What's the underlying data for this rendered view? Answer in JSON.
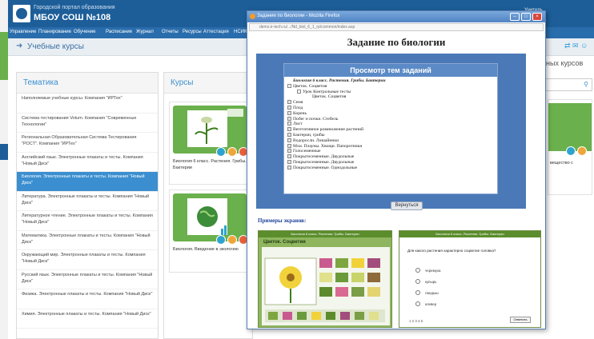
{
  "portal": {
    "city": "Городской портал образования",
    "school": "МБОУ СОШ №108",
    "user_line1": "Учитель",
    "user_line2": "Выход",
    "nav": [
      "Управление",
      "Планирование",
      "Обучение",
      "Расписание",
      "Журнал",
      "Отчеты",
      "Ресурсы",
      "Аттестация",
      "НСИКО"
    ],
    "breadcrumb": "Учебные курсы",
    "thematic_title": "Тематика",
    "courses_title": "Курсы",
    "right_title": "ных курсов",
    "topics": [
      "Наполняемые учебные курсы. Компания \"ИРТех\"",
      "Система тестирования Votum. Компания \"Современные Технологии\"",
      "Региональная Образовательная Система Тестирования \"РОСТ\". Компания \"ИРТех\"",
      "Английский язык. Электронные плакаты и тесты. Компания \"Новый Диск\"",
      "Биология. Электронные плакаты и тесты. Компания \"Новый Диск\"",
      "Литература. Электронные плакаты и тесты. Компания \"Новый Диск\"",
      "Литературное чтение. Электронные плакаты и тесты. Компания \"Новый Диск\"",
      "Математика. Электронные плакаты и тесты. Компания \"Новый Диск\"",
      "Окружающий мир. Электронные плакаты и тесты. Компания \"Новый Диск\"",
      "Русский язык. Электронные плакаты и тесты. Компания \"Новый Диск\"",
      "Физика. Электронные плакаты и тесты. Компания \"Новый Диск\"",
      "Химия. Электронные плакаты и тесты. Компания \"Новый Диск\""
    ],
    "active_topic_index": 4,
    "courses": [
      {
        "title": "Биология 6 класс. Растения. Грибы. Бактерии"
      },
      {
        "title": "Биология. Введение в экологию"
      }
    ],
    "right_card_text": "вещество с"
  },
  "window": {
    "title": "Задание по биологии - Mozilla Firefox",
    "url": "demo.ir-tech.ru/.../Nd_biol_6_1_rp/common/index.asp",
    "heading": "Задание по биологии",
    "tree_title": "Просмотр тем заданий",
    "tree_items": [
      {
        "text": "Биология 6 класс. Растения. Грибы. Бактерии",
        "level": 0,
        "box": "none",
        "style": "bold-italic"
      },
      {
        "text": "Цветок. Соцветия",
        "level": 0,
        "box": "minus",
        "style": "normal"
      },
      {
        "text": "Урок Контрольные тесты",
        "level": 1,
        "box": "minus",
        "style": "normal"
      },
      {
        "text": "Цветок. Соцветия",
        "level": 2,
        "box": "none",
        "style": "normal"
      },
      {
        "text": "Семя",
        "level": 0,
        "box": "plus",
        "style": "normal"
      },
      {
        "text": "Плод",
        "level": 0,
        "box": "plus",
        "style": "normal"
      },
      {
        "text": "Корень",
        "level": 0,
        "box": "plus",
        "style": "normal"
      },
      {
        "text": "Побег и почки. Стебель",
        "level": 0,
        "box": "plus",
        "style": "normal"
      },
      {
        "text": "Лист",
        "level": 0,
        "box": "plus",
        "style": "normal"
      },
      {
        "text": "Вегетативное размножение растений",
        "level": 0,
        "box": "plus",
        "style": "normal"
      },
      {
        "text": "Бактерии, грибы",
        "level": 0,
        "box": "plus",
        "style": "normal"
      },
      {
        "text": "Водоросли. Лишайники",
        "level": 0,
        "box": "plus",
        "style": "normal"
      },
      {
        "text": "Мхи. Плауны. Хвощи. Папоротники",
        "level": 0,
        "box": "plus",
        "style": "normal"
      },
      {
        "text": "Голосеменные",
        "level": 0,
        "box": "plus",
        "style": "normal"
      },
      {
        "text": "Покрытосеменные. Двудольные",
        "level": 0,
        "box": "plus",
        "style": "normal"
      },
      {
        "text": "Покрытосеменные. Двудольные",
        "level": 0,
        "box": "plus",
        "style": "normal"
      },
      {
        "text": "Покрытосеменные. Однодольные",
        "level": 0,
        "box": "plus",
        "style": "normal"
      }
    ],
    "back_button": "Вернуться",
    "examples_label": "Примеры экранов:",
    "shot1": {
      "header": "Биология 6 класс. Растения. Грибы. Бактерии",
      "title": "Цветок. Соцветия"
    },
    "shot2": {
      "header": "Биология 6 класс. Растения. Грибы. Бактерии",
      "question": "Для какого растения характерно соцветие головка?",
      "options": [
        "черемуха",
        "купырь",
        "ландыш",
        "клевер"
      ],
      "pager": "1  2  3  4  5",
      "next": "Ответить"
    }
  },
  "colors": {
    "portal_blue": "#1d5e99",
    "accent_blue": "#3b8fd0",
    "window_frame": "#4b79b8",
    "green": "#6ab04c"
  }
}
